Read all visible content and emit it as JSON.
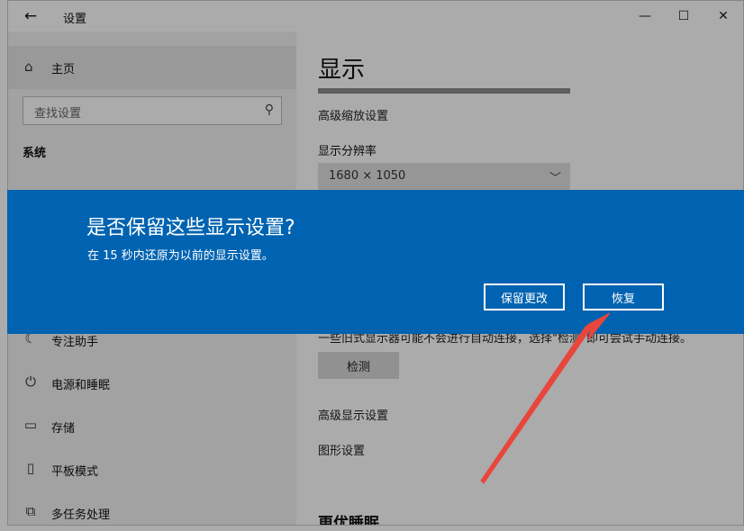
{
  "window": {
    "back_icon": "back-arrow-icon",
    "title": "设置",
    "controls": {
      "minimize": "minimize-icon",
      "maximize": "maximize-icon",
      "close": "close-icon"
    }
  },
  "sidebar": {
    "home_label": "主页",
    "search_placeholder": "查找设置",
    "section": "系统",
    "items": [
      {
        "label": "专注助手",
        "icon": "moon-icon"
      },
      {
        "label": "电源和睡眠",
        "icon": "power-icon"
      },
      {
        "label": "存储",
        "icon": "storage-icon"
      },
      {
        "label": "平板模式",
        "icon": "tablet-icon"
      },
      {
        "label": "多任务处理",
        "icon": "multitask-icon"
      }
    ]
  },
  "content": {
    "title": "显示",
    "advanced_scaling": "高级缩放设置",
    "resolution_label": "显示分辨率",
    "resolution_value": "1680 × 1050",
    "detect_description": "一些旧式显示器可能不会进行自动连接，选择\"检测\"即可尝试手动连接。",
    "detect_button": "检测",
    "advanced_display": "高级显示设置",
    "graphics_settings": "图形设置",
    "section_sleep": "更优睡眠"
  },
  "dialog": {
    "heading": "是否保留这些显示设置?",
    "message": "在 15 秒内还原为以前的显示设置。",
    "keep_button": "保留更改",
    "revert_button": "恢复",
    "background_color": "#0063b1"
  },
  "annotation": {
    "color": "#e8463c"
  }
}
